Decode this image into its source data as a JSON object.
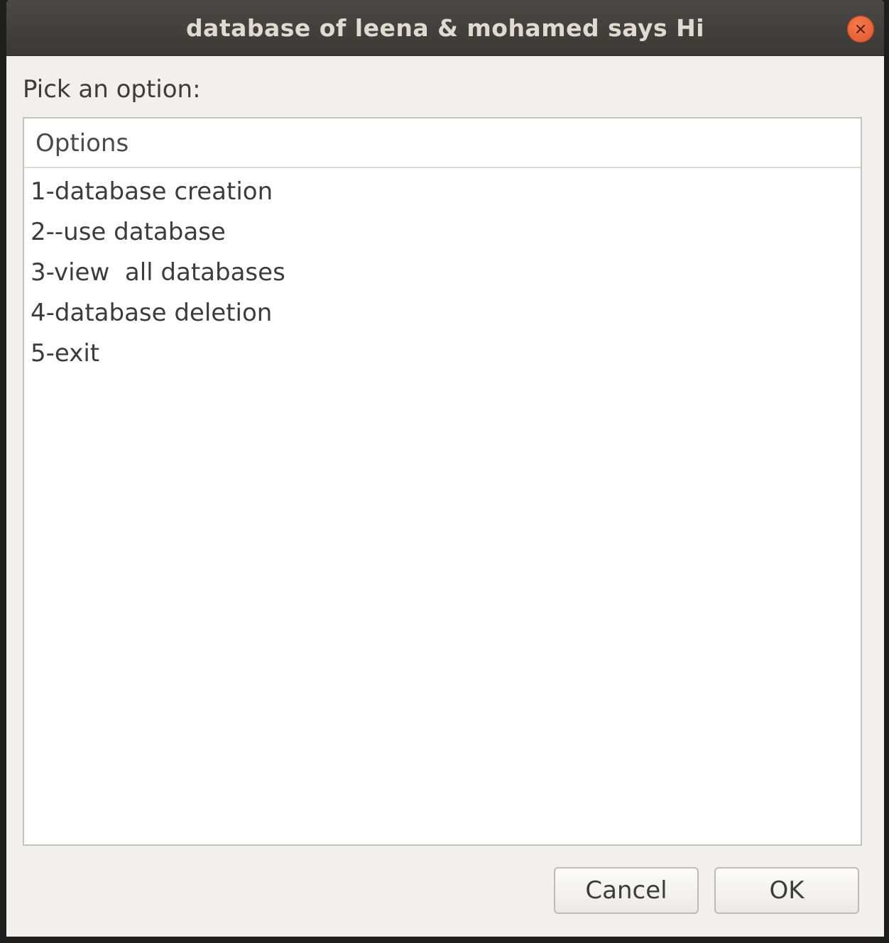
{
  "window": {
    "title": "database of leena & mohamed says Hi"
  },
  "dialog": {
    "prompt": "Pick an option:",
    "list": {
      "column_header": "Options",
      "items": [
        "1-database creation",
        "2--use database",
        "3-view  all databases",
        "4-database deletion",
        "5-exit"
      ]
    },
    "buttons": {
      "cancel_label": "Cancel",
      "ok_label": "OK"
    }
  },
  "icons": {
    "close": "close-icon"
  },
  "colors": {
    "close_button": "#e0542a",
    "titlebar": "#3f3e3a",
    "window_bg": "#f1f0ef"
  }
}
